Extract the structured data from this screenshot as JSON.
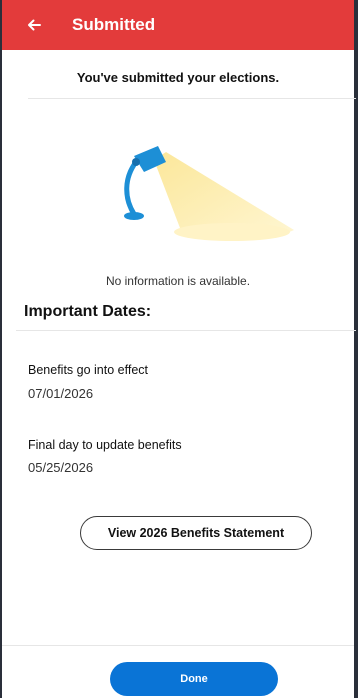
{
  "header": {
    "title": "Submitted",
    "background_color": "#e33b3b",
    "back_icon": "arrow-left-icon"
  },
  "confirmation": {
    "message": "You've submitted your elections."
  },
  "empty_state": {
    "illustration": "desk-lamp-icon",
    "message": "No information is available."
  },
  "important_dates": {
    "heading": "Important Dates:",
    "items": [
      {
        "label": "Benefits go into effect",
        "date": "07/01/2026"
      },
      {
        "label": "Final day to update  benefits",
        "date": "05/25/2026"
      }
    ]
  },
  "actions": {
    "statement_label": "View 2026 Benefits Statement",
    "done_label": "Done",
    "done_color": "#0a74d6"
  }
}
